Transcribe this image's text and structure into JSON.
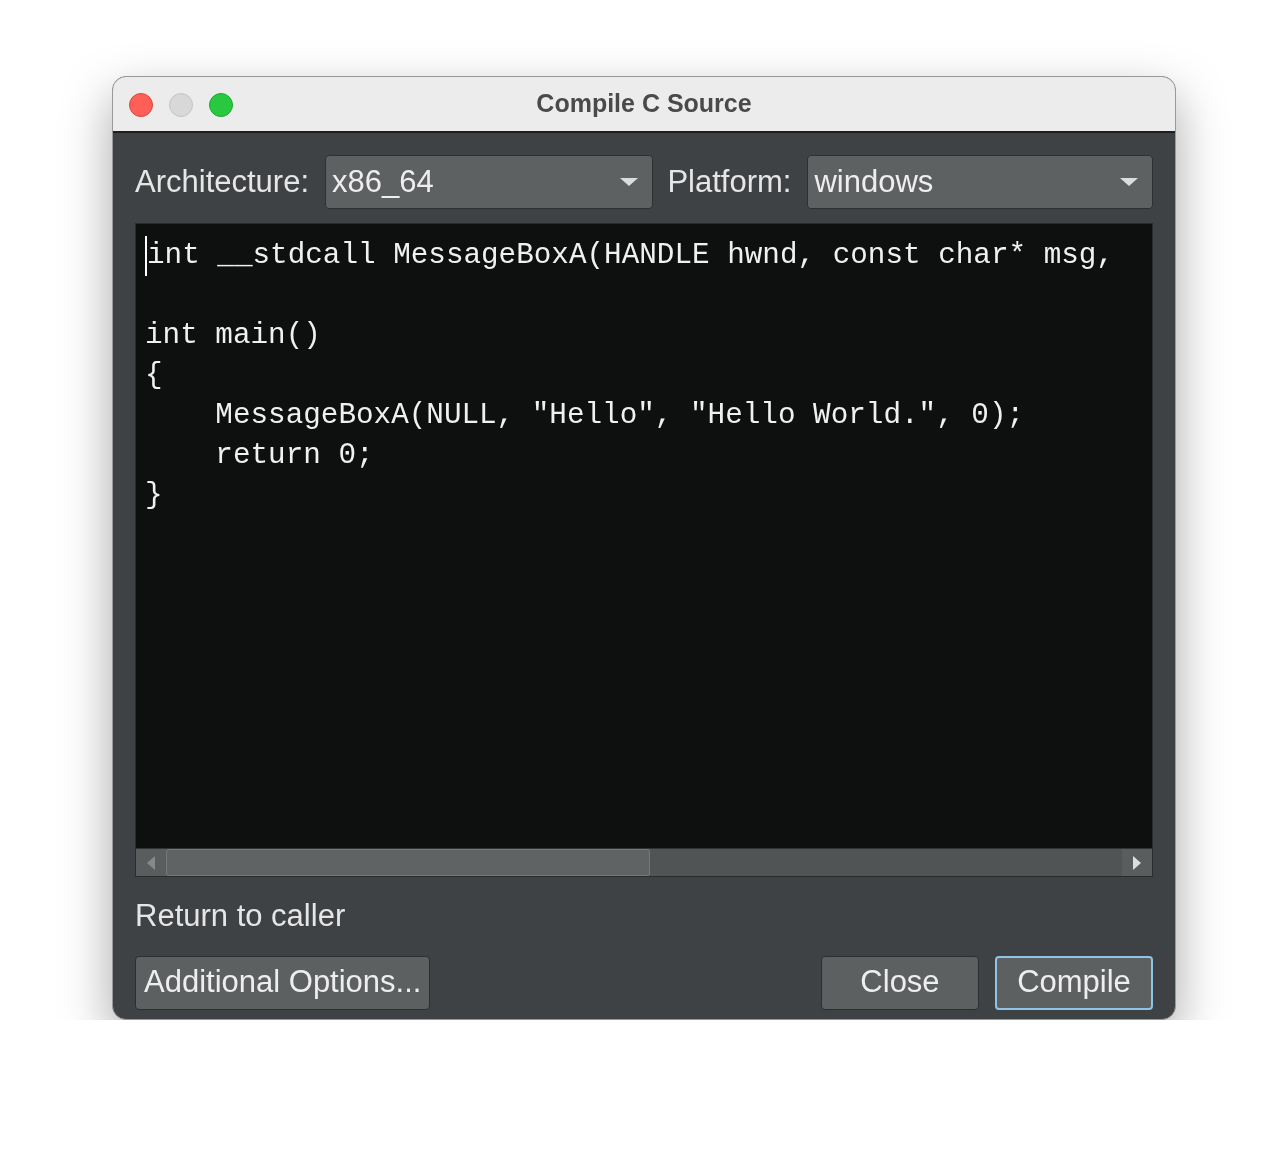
{
  "window": {
    "title": "Compile C Source"
  },
  "traffic_lights": [
    {
      "kind": "close"
    },
    {
      "kind": "minimize"
    },
    {
      "kind": "zoom"
    }
  ],
  "selectors": [
    {
      "label": "Architecture:",
      "value": "x86_64"
    },
    {
      "label": "Platform:",
      "value": "windows"
    }
  ],
  "editor": {
    "paragraphs": [
      [
        {
          "text": "int __stdcall MessageBoxA(HANDLE hwnd, const char* msg,",
          "caret": true
        }
      ],
      [
        {
          "text": "int main()",
          "caret": false
        },
        {
          "text": "{",
          "caret": false
        },
        {
          "text": "    MessageBoxA(NULL, \"Hello\", \"Hello World.\", 0);",
          "caret": false
        },
        {
          "text": "    return 0;",
          "caret": false
        },
        {
          "text": "}",
          "caret": false
        }
      ]
    ]
  },
  "status": "Return to caller",
  "options_button": {
    "label": "Additional Options..."
  },
  "buttons": [
    {
      "label": "Close",
      "default": false
    },
    {
      "label": "Compile",
      "default": true
    }
  ]
}
